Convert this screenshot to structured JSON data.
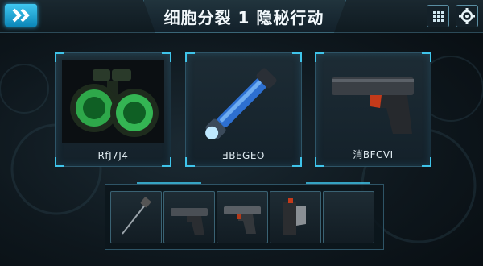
{
  "header": {
    "title": "细胞分裂 1 隐秘行动",
    "back_icon": "double-chevron-right-icon",
    "grid_icon": "grid-menu-icon",
    "settings_icon": "gear-icon"
  },
  "cards": [
    {
      "label": "RfJ7J4",
      "icon": "night-vision-goggles-icon",
      "selected": true
    },
    {
      "label": "ƎBEGEO",
      "icon": "flashlight-icon",
      "selected": false
    },
    {
      "label": "消BFCVI",
      "icon": "pistol-icon",
      "selected": false
    }
  ],
  "inventory": {
    "slots": [
      {
        "icon": "lockpick-tool-icon"
      },
      {
        "icon": "pistol-icon"
      },
      {
        "icon": "pistol-icon"
      },
      {
        "icon": "holster-icon"
      },
      {
        "icon": "empty-slot"
      }
    ]
  },
  "colors": {
    "accent": "#3fc4ea",
    "panel_border": "#2e5466",
    "background": "#0e171d"
  }
}
